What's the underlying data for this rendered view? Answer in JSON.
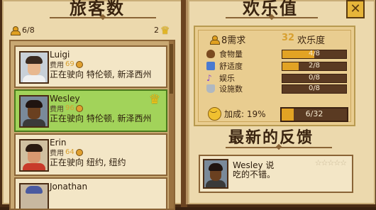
{
  "left_page": {
    "title": "旅客数",
    "guest_count": "6/8",
    "crown_count": "2",
    "guests": [
      {
        "name": "Luigi",
        "fee_label": "费用",
        "fee": "69",
        "destination": "正在驶向 特伦顿, 新泽西州",
        "selected": false,
        "crown": false
      },
      {
        "name": "Wesley",
        "fee_label": "费用",
        "fee": "96",
        "destination": "正在驶向 特伦顿, 新泽西州",
        "selected": true,
        "crown": true
      },
      {
        "name": "Erin",
        "fee_label": "费用",
        "fee": "64",
        "destination": "正在驶向 纽约, 纽约",
        "selected": false,
        "crown": false
      },
      {
        "name": "Jonathan",
        "fee_label": "",
        "fee": "",
        "destination": "",
        "selected": false,
        "crown": false
      }
    ]
  },
  "right_page": {
    "title": "欢乐值",
    "close_label": "✕",
    "stats": {
      "need_label": "8需求",
      "joy_value": "32",
      "joy_label": "欢乐度",
      "rows": [
        {
          "label": "食物量",
          "value": "4/8",
          "fraction": 0.5,
          "icon": "food-icon"
        },
        {
          "label": "舒适度",
          "value": "2/8",
          "fraction": 0.25,
          "icon": "bed-icon"
        },
        {
          "label": "娱乐",
          "value": "0/8",
          "fraction": 0,
          "icon": "music-icon"
        },
        {
          "label": "设施数",
          "value": "0/8",
          "fraction": 0,
          "icon": "toilet-icon"
        }
      ],
      "bonus_label": "加成: 19%",
      "bonus_value": "6/32",
      "bonus_fraction": 0.1875
    },
    "feedback_title": "最新的反馈",
    "feedback": {
      "name": "Wesley 说",
      "text": "吃的不错。",
      "stars": "☆☆☆☆☆"
    }
  },
  "colors": {
    "selected_card": "#a2d35a",
    "bar_fill": "#e2a324",
    "page": "#ecd9ad"
  }
}
